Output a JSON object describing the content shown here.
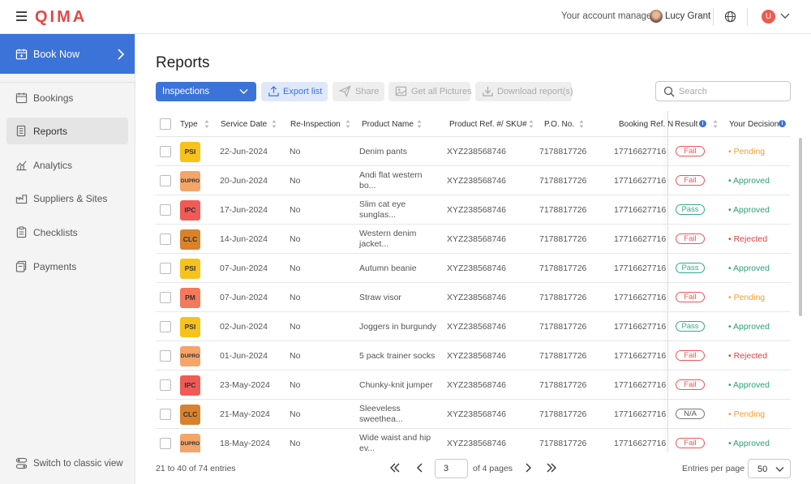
{
  "app": {
    "logo": "QIMA"
  },
  "header": {
    "account_manager_label": "Your account manager:",
    "account_manager_name": "Lucy Grant",
    "user_initial": "U"
  },
  "sidebar": {
    "book_now": "Book Now",
    "items": [
      {
        "label": "Bookings",
        "icon": "calendar-icon"
      },
      {
        "label": "Reports",
        "icon": "document-icon",
        "active": true
      },
      {
        "label": "Analytics",
        "icon": "chart-icon"
      },
      {
        "label": "Suppliers & Sites",
        "icon": "factory-icon"
      },
      {
        "label": "Checklists",
        "icon": "clipboard-icon"
      },
      {
        "label": "Payments",
        "icon": "payment-icon"
      }
    ],
    "switch_classic": "Switch to classic view"
  },
  "main": {
    "title": "Reports",
    "toolbar": {
      "select_value": "Inspections",
      "export": "Export list",
      "share": "Share",
      "get_pictures": "Get all Pictures",
      "download": "Download report(s)",
      "search_placeholder": "Search"
    },
    "columns": [
      "Type",
      "Service Date",
      "Re-Inspection",
      "Product Name",
      "Product Ref. #/ SKU#",
      "P.O. No.",
      "Booking Ref. N",
      "Result",
      "Your Decision"
    ],
    "rows": [
      {
        "type": "PSI",
        "date": "22-Jun-2024",
        "reinsp": "No",
        "product": "Denim pants",
        "sku": "XYZ238568746",
        "po": "7178817726",
        "booking": "17716627716",
        "result": "Fail",
        "decision": "Pending"
      },
      {
        "type": "DUPRO",
        "date": "20-Jun-2024",
        "reinsp": "No",
        "product": "Andi flat western bo...",
        "sku": "XYZ238568746",
        "po": "7178817726",
        "booking": "17716627716",
        "result": "Fail",
        "decision": "Approved"
      },
      {
        "type": "IPC",
        "date": "17-Jun-2024",
        "reinsp": "No",
        "product": "Slim cat eye sunglas...",
        "sku": "XYZ238568746",
        "po": "7178817726",
        "booking": "17716627716",
        "result": "Pass",
        "decision": "Approved"
      },
      {
        "type": "CLC",
        "date": "14-Jun-2024",
        "reinsp": "No",
        "product": "Western denim jacket...",
        "sku": "XYZ238568746",
        "po": "7178817726",
        "booking": "17716627716",
        "result": "Fail",
        "decision": "Rejected"
      },
      {
        "type": "PSI",
        "date": "07-Jun-2024",
        "reinsp": "No",
        "product": "Autumn beanie",
        "sku": "XYZ238568746",
        "po": "7178817726",
        "booking": "17716627716",
        "result": "Pass",
        "decision": "Approved"
      },
      {
        "type": "PM",
        "date": "07-Jun-2024",
        "reinsp": "No",
        "product": "Straw visor",
        "sku": "XYZ238568746",
        "po": "7178817726",
        "booking": "17716627716",
        "result": "Fail",
        "decision": "Pending"
      },
      {
        "type": "PSI",
        "date": "02-Jun-2024",
        "reinsp": "No",
        "product": "Joggers in burgundy",
        "sku": "XYZ238568746",
        "po": "7178817726",
        "booking": "17716627716",
        "result": "Pass",
        "decision": "Approved"
      },
      {
        "type": "DUPRO",
        "date": "01-Jun-2024",
        "reinsp": "No",
        "product": "5 pack trainer socks",
        "sku": "XYZ238568746",
        "po": "7178817726",
        "booking": "17716627716",
        "result": "Fail",
        "decision": "Rejected"
      },
      {
        "type": "IPC",
        "date": "23-May-2024",
        "reinsp": "No",
        "product": "Chunky-knit jumper",
        "sku": "XYZ238568746",
        "po": "7178817726",
        "booking": "17716627716",
        "result": "Fail",
        "decision": "Approved"
      },
      {
        "type": "CLC",
        "date": "21-May-2024",
        "reinsp": "No",
        "product": "Sleeveless sweethea...",
        "sku": "XYZ238568746",
        "po": "7178817726",
        "booking": "17716627716",
        "result": "N/A",
        "decision": "Pending"
      },
      {
        "type": "DUPRO",
        "date": "18-May-2024",
        "reinsp": "No",
        "product": "Wide waist and hip ev...",
        "sku": "XYZ238568746",
        "po": "7178817726",
        "booking": "17716627716",
        "result": "Fail",
        "decision": "Approved"
      }
    ],
    "type_colors": {
      "PSI": "#f8c21c",
      "DUPRO": "#f3a56a",
      "IPC": "#f15b55",
      "CLC": "#d9822b",
      "PM": "#f47a5c"
    }
  },
  "footer": {
    "entries_text": "21 to 40 of 74 entries",
    "current_page": "3",
    "of_pages": "of 4 pages",
    "entries_per_page_label": "Entries per page",
    "entries_per_page": "50"
  }
}
